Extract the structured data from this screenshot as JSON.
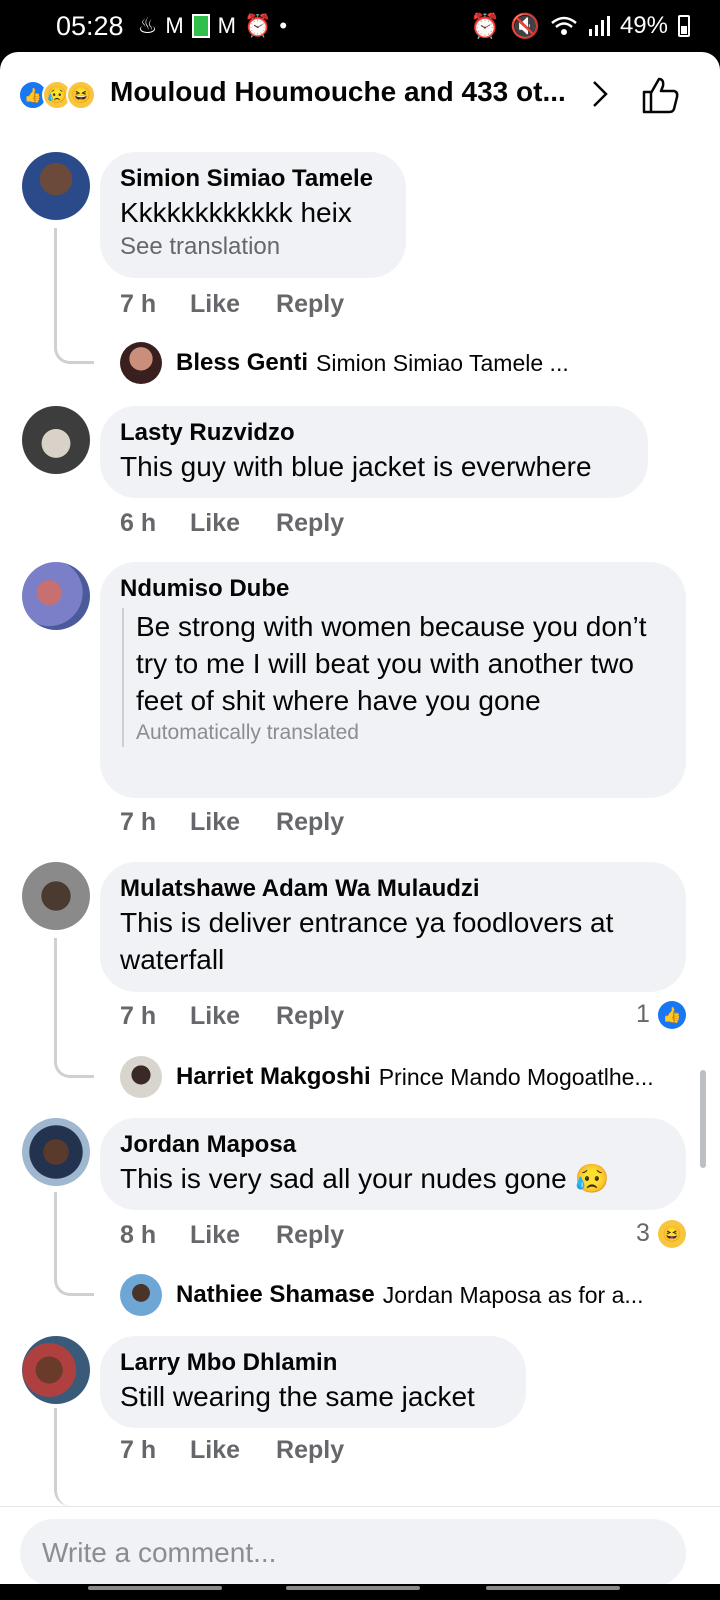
{
  "status_bar": {
    "time": "05:28",
    "battery": "49%",
    "left_icons": [
      "notification-icon",
      "gmail-icon",
      "battery-saver-icon",
      "gmail-icon",
      "alarm-icon",
      "dot-icon"
    ],
    "right_icons": [
      "alarm-icon",
      "mute-icon",
      "wifi-icon",
      "signal-icon",
      "battery-icon"
    ]
  },
  "header": {
    "title": "Mouloud Houmouche and 433 ot...",
    "reactions": [
      "like",
      "sad",
      "haha"
    ]
  },
  "comments": [
    {
      "name": "Simion Simiao Tamele",
      "text": "Kkkkkkkkkkkk heix",
      "sub": "See translation",
      "time": "7 h",
      "like": "Like",
      "reply": "Reply",
      "reply_preview": {
        "name": "Bless Genti",
        "text": "Simion Simiao Tamele ..."
      }
    },
    {
      "name": "Lasty Ruzvidzo",
      "text": "This guy with blue jacket is everwhere",
      "time": "6 h",
      "like": "Like",
      "reply": "Reply"
    },
    {
      "name": "Ndumiso Dube",
      "text": "Be strong with women because you don’t try to me I will beat you with another two feet of shit where have you gone",
      "sub": "Automatically translated",
      "time": "7 h",
      "like": "Like",
      "reply": "Reply"
    },
    {
      "name": "Mulatshawe Adam Wa Mulaudzi",
      "text": "This is deliver entrance ya foodlovers at waterfall",
      "time": "7 h",
      "like": "Like",
      "reply": "Reply",
      "reaction_count": "1",
      "reaction": "like",
      "reply_preview": {
        "name": "Harriet Makgoshi",
        "text": "Prince Mando Mogoatlhe..."
      }
    },
    {
      "name": "Jordan Maposa",
      "text": "This  is very  sad   all your nudes gone 😥",
      "time": "8 h",
      "like": "Like",
      "reply": "Reply",
      "reaction_count": "3",
      "reaction": "haha",
      "reply_preview": {
        "name": "Nathiee Shamase",
        "text": "Jordan Maposa as for a..."
      }
    },
    {
      "name": "Larry Mbo Dhlamin",
      "text": "Still wearing the same jacket",
      "time": "7 h",
      "like": "Like",
      "reply": "Reply"
    }
  ],
  "composer": {
    "placeholder": "Write a comment..."
  },
  "colors": {
    "bubble": "#f0f2f5",
    "like_blue": "#1877f2",
    "haha_yellow": "#f7c53e",
    "secondary_text": "#65676b"
  }
}
